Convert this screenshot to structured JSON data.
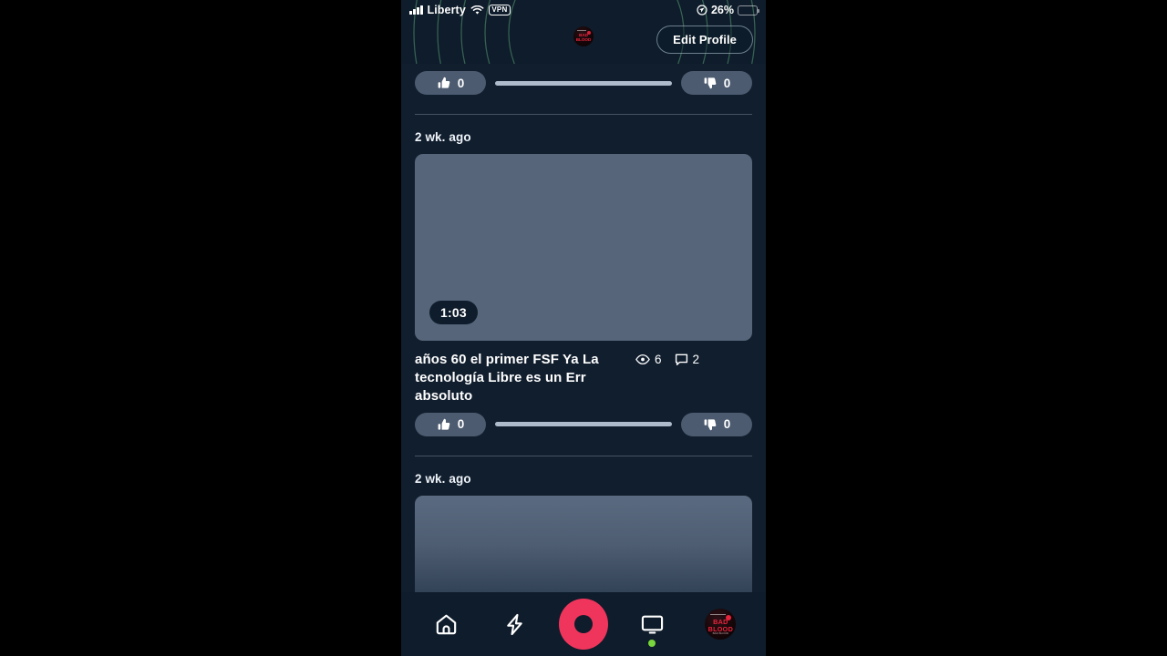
{
  "colors": {
    "app_background": "#111e2e",
    "header_background": "#0e1c2b",
    "accent_record": "#f0355c",
    "live_dot": "#79d63c",
    "pill": "#4c5b70",
    "track": "#aebbcb",
    "thumbnail_placeholder": "#56657a",
    "battery_fill": "#f5d020",
    "arc_stroke": "#3c6b52",
    "avatar_text": "#e8243c"
  },
  "status_bar": {
    "carrier": "Liberty",
    "signal_icon": "signal-bars-icon",
    "wifi_icon": "wifi-icon",
    "vpn_badge": "VPN",
    "location_icon": "location-arrow-icon",
    "battery_percent": "26%",
    "battery_level": 26,
    "battery_icon": "battery-icon"
  },
  "header": {
    "avatar_icon": "profile-avatar",
    "avatar_line1": "BAD",
    "avatar_line2": "BLOOD",
    "edit_profile_label": "Edit Profile"
  },
  "feed": {
    "partial_top_rating": {
      "like_icon": "thumbs-up-icon",
      "like_count": "0",
      "dislike_icon": "thumbs-down-icon",
      "dislike_count": "0"
    },
    "items": [
      {
        "timestamp": "2 wk. ago",
        "duration": "1:03",
        "title": "años 60 el primer FSF Ya La tecnología Libre es un Err absoluto",
        "views_icon": "eye-icon",
        "views": "6",
        "comments_icon": "comment-bubble-icon",
        "comments": "2",
        "like_icon": "thumbs-up-icon",
        "like_count": "0",
        "dislike_icon": "thumbs-down-icon",
        "dislike_count": "0"
      },
      {
        "timestamp": "2 wk. ago"
      }
    ]
  },
  "nav": {
    "items": [
      {
        "icon": "home-icon",
        "name": "home"
      },
      {
        "icon": "lightning-bolt-icon",
        "name": "trending"
      },
      {
        "icon": "record-button-icon",
        "name": "record"
      },
      {
        "icon": "monitor-icon",
        "name": "live"
      },
      {
        "icon": "account-avatar-icon",
        "name": "account"
      }
    ],
    "avatar_line1": "BAD",
    "avatar_line2": "BLOOD",
    "avatar_sub": "BAD BLOOD"
  }
}
